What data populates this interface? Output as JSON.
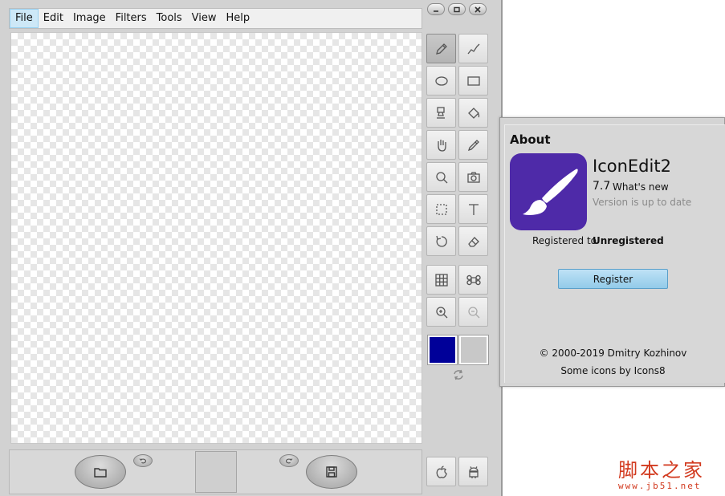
{
  "menu": {
    "items": [
      {
        "label": "File"
      },
      {
        "label": "Edit"
      },
      {
        "label": "Image"
      },
      {
        "label": "Filters"
      },
      {
        "label": "Tools"
      },
      {
        "label": "View"
      },
      {
        "label": "Help"
      }
    ],
    "active": "File"
  },
  "window_controls": [
    "minimize-icon",
    "restore-icon",
    "close-icon"
  ],
  "tools": [
    {
      "name": "pencil-icon",
      "selected": true
    },
    {
      "name": "line-icon",
      "selected": false
    },
    {
      "name": "ellipse-icon",
      "selected": false
    },
    {
      "name": "rectangle-icon",
      "selected": false
    },
    {
      "name": "stamp-icon",
      "selected": false
    },
    {
      "name": "fill-bucket-icon",
      "selected": false
    },
    {
      "name": "hand-icon",
      "selected": false
    },
    {
      "name": "eyedropper-icon",
      "selected": false
    },
    {
      "name": "magnifier-icon",
      "selected": false
    },
    {
      "name": "camera-icon",
      "selected": false
    },
    {
      "name": "selection-icon",
      "selected": false
    },
    {
      "name": "text-icon",
      "selected": false
    },
    {
      "name": "rotate-icon",
      "selected": false
    },
    {
      "name": "eraser-icon",
      "selected": false
    },
    {
      "name": "grid-icon",
      "selected": false
    },
    {
      "name": "command-icon",
      "selected": false
    },
    {
      "name": "zoom-in-icon",
      "selected": false
    },
    {
      "name": "zoom-out-icon",
      "selected": false
    }
  ],
  "colors": {
    "primary": "#000099",
    "secondary": "#c8c8c8",
    "accent": "#4e2aa8"
  },
  "platform_buttons": [
    "apple-icon",
    "android-icon"
  ],
  "bottom_bar": [
    "open-folder-icon",
    "undo-icon",
    "redo-icon",
    "save-icon"
  ],
  "about": {
    "title": "About",
    "app_name": "IconEdit2",
    "version": "7.7",
    "whats_new": "What's new",
    "status": "Version is up to date",
    "registered_label": "Registered to",
    "registered_value": "Unregistered",
    "register_button": "Register",
    "copyright": "© 2000-2019 Dmitry Kozhinov",
    "icons_credit": "Some icons by Icons8"
  },
  "watermark": {
    "text": "脚本之家",
    "url": "www.jb51.net"
  }
}
